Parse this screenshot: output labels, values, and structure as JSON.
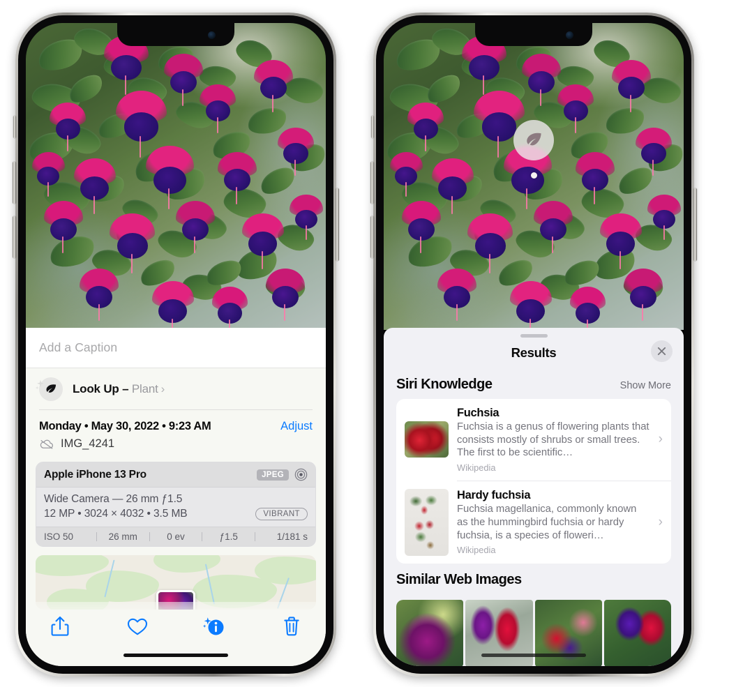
{
  "left_phone": {
    "name": "iPhone photo info screen",
    "caption_field": {
      "placeholder": "Add a Caption",
      "value": ""
    },
    "look_up": {
      "label": "Look Up – ",
      "category": "Plant",
      "chevron": "›",
      "icon": "leaf-icon",
      "sparkle_icon": "sparkle-icon"
    },
    "meta": {
      "date": "Monday • May 30, 2022 • 9:23 AM",
      "adjust_label": "Adjust",
      "filename": "IMG_4241",
      "cloud_icon": "cloud-slash-icon"
    },
    "exif": {
      "model": "Apple iPhone 13 Pro",
      "format_badge": "JPEG",
      "raw_icon": "target-circle-icon",
      "lens_line": "Wide Camera — 26 mm ƒ1.5",
      "size_line": "12 MP • 3024 × 4032 • 3.5 MB",
      "style_badge": "VIBRANT",
      "settings": [
        "ISO 50",
        "26 mm",
        "0 ev",
        "ƒ1.5",
        "1/181 s"
      ]
    },
    "map": {
      "name": "location-map-card",
      "pin": "photo-pin"
    },
    "toolbar": [
      {
        "name": "share-button",
        "icon": "share-icon"
      },
      {
        "name": "favorite-button",
        "icon": "heart-icon"
      },
      {
        "name": "info-button",
        "icon": "info-sparkle-icon"
      },
      {
        "name": "delete-button",
        "icon": "trash-icon"
      }
    ]
  },
  "right_phone": {
    "name": "iPhone visual look up results screen",
    "vlu_badge": {
      "icon": "leaf-icon",
      "name": "visual-look-up-badge"
    },
    "sheet": {
      "title": "Results",
      "close_icon": "close-icon",
      "siri_knowledge": {
        "title": "Siri Knowledge",
        "show_more": "Show More",
        "entries": [
          {
            "title": "Fuchsia",
            "description": "Fuchsia is a genus of flowering plants that consists mostly of shrubs or small trees. The first to be scientific…",
            "source": "Wikipedia",
            "chevron": "›"
          },
          {
            "title": "Hardy fuchsia",
            "description": "Fuchsia magellanica, commonly known as the hummingbird fuchsia or hardy fuchsia, is a species of floweri…",
            "source": "Wikipedia",
            "chevron": "›"
          }
        ]
      },
      "similar_web_images": {
        "title": "Similar Web Images",
        "count": 4
      }
    }
  },
  "colors": {
    "accent_blue": "#0b7bff",
    "sheet_bg": "#f1f1f5",
    "info_bg": "#f7f8f3",
    "card_gray": "#e6e6e8",
    "secondary_text": "#75757d"
  }
}
